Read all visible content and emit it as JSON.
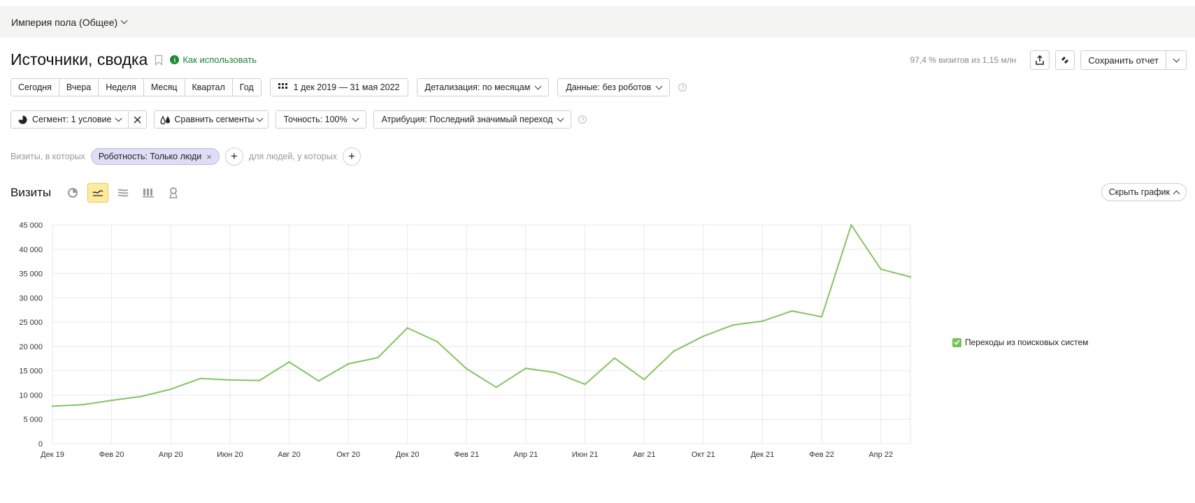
{
  "header": {
    "counter_name": "Империя пола (Общее)",
    "page_title": "Источники, сводка",
    "how_to_use": "Как использовать",
    "visits_share": "97,4 % визитов из 1,15 млн",
    "save_report": "Сохранить отчет"
  },
  "periods": [
    "Сегодня",
    "Вчера",
    "Неделя",
    "Месяц",
    "Квартал",
    "Год"
  ],
  "date_range": "1 дек 2019 — 31 мая 2022",
  "detail": "Детализация: по месяцам",
  "data_filter": "Данные: без роботов",
  "segment": "Сегмент: 1 условие",
  "compare": "Сравнить сегменты",
  "accuracy": "Точность: 100%",
  "attribution": "Атрибуция: Последний значимый переход",
  "filters": {
    "visits_where": "Визиты, в которых",
    "chip": "Роботность: Только люди",
    "people_where": "для людей, у которых"
  },
  "chart_header": {
    "title": "Визиты",
    "hide": "Скрыть график"
  },
  "colors": {
    "line": "#84c461",
    "accent": "#ffeba0",
    "chip": "#ddddf6"
  },
  "chart_data": {
    "type": "line",
    "x": [
      "Дек 19",
      "Янв 20",
      "Фев 20",
      "Мар 20",
      "Апр 20",
      "Май 20",
      "Июн 20",
      "Июл 20",
      "Авг 20",
      "Сен 20",
      "Окт 20",
      "Ноя 20",
      "Дек 20",
      "Янв 21",
      "Фев 21",
      "Мар 21",
      "Апр 21",
      "Май 21",
      "Июн 21",
      "Июл 21",
      "Авг 21",
      "Сен 21",
      "Окт 21",
      "Ноя 21",
      "Дек 21",
      "Янв 22",
      "Фев 22",
      "Мар 22",
      "Апр 22",
      "Май 22"
    ],
    "tick_labels": [
      "Дек 19",
      "Фев 20",
      "Апр 20",
      "Июн 20",
      "Авг 20",
      "Окт 20",
      "Дек 20",
      "Фев 21",
      "Апр 21",
      "Июн 21",
      "Авг 21",
      "Окт 21",
      "Дек 21",
      "Фев 22",
      "Апр 22"
    ],
    "y_tick_labels": [
      "0",
      "5 000",
      "10 000",
      "15 000",
      "20 000",
      "25 000",
      "30 000",
      "35 000",
      "40 000",
      "45 000"
    ],
    "series": [
      {
        "name": "Переходы из поисковых систем",
        "values": [
          7700,
          8000,
          8900,
          9700,
          11200,
          13400,
          13100,
          13000,
          16800,
          12900,
          16400,
          17700,
          23800,
          21000,
          15400,
          11600,
          15500,
          14600,
          12200,
          17600,
          13200,
          19000,
          22100,
          24400,
          25200,
          27300,
          26100,
          45000,
          35900,
          34300
        ]
      }
    ],
    "ylim": [
      0,
      45000
    ],
    "grid": true,
    "legend": "right"
  }
}
